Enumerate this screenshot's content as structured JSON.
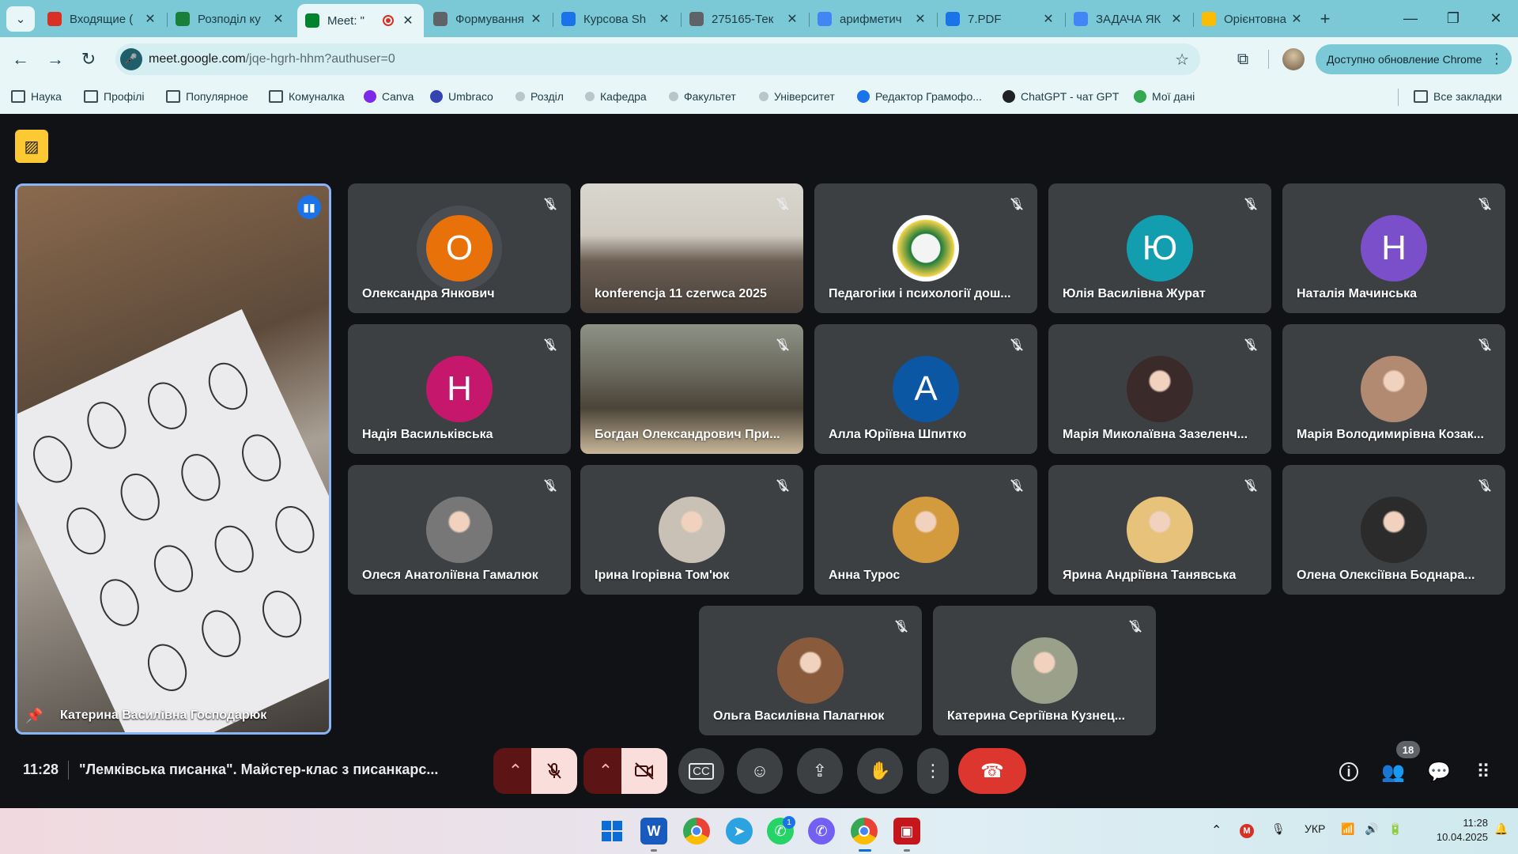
{
  "tabs": [
    {
      "title": "Входящие (",
      "icon": "gmail-icon",
      "color": "#d93025"
    },
    {
      "title": "Розподіл ку",
      "icon": "green-plus-icon",
      "color": "#188038"
    },
    {
      "title": "Meet: \"",
      "icon": "meet-icon",
      "color": "#00832d",
      "active": true,
      "recording": true
    },
    {
      "title": "Формування",
      "icon": "globe-icon",
      "color": "#5f6368"
    },
    {
      "title": "Курсова Sh",
      "icon": "flag-icon",
      "color": "#1a73e8"
    },
    {
      "title": "275165-Тек",
      "icon": "globe-icon",
      "color": "#5f6368"
    },
    {
      "title": "арифметич",
      "icon": "google-icon",
      "color": "#4285f4"
    },
    {
      "title": "7.PDF",
      "icon": "pdf-icon",
      "color": "#1a73e8"
    },
    {
      "title": "ЗАДАЧА ЯК",
      "icon": "google-icon",
      "color": "#4285f4"
    },
    {
      "title": "Орієнтовна",
      "icon": "drive-icon",
      "color": "#fbbc04"
    }
  ],
  "address": {
    "host": "meet.google.com",
    "path": "/jqe-hgrh-hhm?authuser=0"
  },
  "update_label": "Доступно обновление Chrome",
  "bookmarks": [
    {
      "label": "Наука",
      "icon": "folder-icon"
    },
    {
      "label": "Профілі",
      "icon": "folder-icon"
    },
    {
      "label": "Популярное",
      "icon": "folder-icon"
    },
    {
      "label": "Комуналка",
      "icon": "folder-icon"
    },
    {
      "label": "Canva",
      "icon": "canva-icon"
    },
    {
      "label": "Umbraco",
      "icon": "umbraco-icon"
    },
    {
      "label": "Розділ",
      "icon": "dot-icon"
    },
    {
      "label": "Кафедра",
      "icon": "dot-icon"
    },
    {
      "label": "Факультет",
      "icon": "dot-icon"
    },
    {
      "label": "Університет",
      "icon": "dot-icon"
    },
    {
      "label": "Редактор Грамофо...",
      "icon": "g-icon"
    },
    {
      "label": "ChatGPT - чат GPT",
      "icon": "openai-icon"
    },
    {
      "label": "Мої дані",
      "icon": "globe-icon"
    }
  ],
  "all_bookmarks": "Все закладки",
  "presenter": {
    "name": "Катерина Василівна Господарюк"
  },
  "participants": [
    {
      "name": "Олександра Янкович",
      "type": "letter",
      "letter": "О",
      "color": "#e8710a",
      "speaking_ring": true
    },
    {
      "name": "konferencja 11 czerwca 2025",
      "type": "video-room"
    },
    {
      "name": "Педагогіки і психології дош...",
      "type": "emblem"
    },
    {
      "name": "Юлія Василівна Журат",
      "type": "letter",
      "letter": "Ю",
      "color": "#129eaf"
    },
    {
      "name": "Наталія Мачинська",
      "type": "letter",
      "letter": "Н",
      "color": "#7b4fc9"
    },
    {
      "name": "Надія Васильківська",
      "type": "letter",
      "letter": "Н",
      "color": "#c5186d"
    },
    {
      "name": "Богдан Олександрович При...",
      "type": "video-class"
    },
    {
      "name": "Алла Юріївна Шпитко",
      "type": "letter",
      "letter": "А",
      "color": "#0b57a4"
    },
    {
      "name": "Марія Миколаївна Зазеленч...",
      "type": "photo",
      "color": "#3a2a2a"
    },
    {
      "name": "Марія Володимирівна Козак...",
      "type": "photo",
      "color": "#b28a72"
    },
    {
      "name": "Олеся Анатоліївна Гамалюк",
      "type": "photo",
      "color": "#777777"
    },
    {
      "name": "Ірина Ігорівна Том'юк",
      "type": "photo",
      "color": "#c9c1b5"
    },
    {
      "name": "Анна Турос",
      "type": "photo",
      "color": "#d39a3e"
    },
    {
      "name": "Ярина Андріївна Танявська",
      "type": "photo",
      "color": "#e6c27a"
    },
    {
      "name": "Олена Олексіївна Боднара...",
      "type": "photo",
      "color": "#2b2b2b"
    },
    {
      "name": "Ольга Василівна Палагнюк",
      "type": "photo",
      "color": "#8a5a3c"
    },
    {
      "name": "Катерина Сергіївна Кузнец...",
      "type": "photo",
      "color": "#9aa08a"
    }
  ],
  "bottom": {
    "time": "11:28",
    "meeting_title": "\"Лемківська писанка\". Майстер-клас з писанкарс...",
    "people_count": "18"
  },
  "taskbar": {
    "lang": "УКР",
    "time": "11:28",
    "date": "10.04.2025",
    "whatsapp_badge": "1"
  }
}
